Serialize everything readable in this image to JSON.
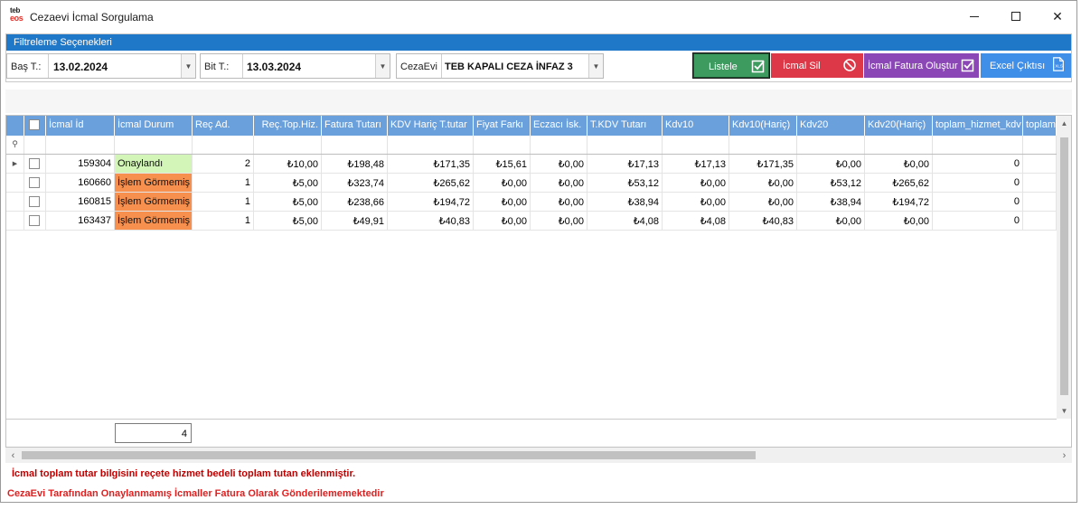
{
  "window": {
    "title": "Cezaevi İcmal Sorgulama",
    "logo_top": "teb",
    "logo_bottom": "eos"
  },
  "filter": {
    "header": "Filtreleme Seçenekleri",
    "start_label": "Baş T.:",
    "start_value": "13.02.2024",
    "end_label": "Bit T.:",
    "end_value": "13.03.2024",
    "prison_label": "CezaEvi",
    "prison_value": "TEB KAPALI CEZA İNFAZ 3"
  },
  "buttons": {
    "list": "Listele",
    "delete": "İcmal Sil",
    "invoice": "İcmal Fatura Oluştur",
    "excel": "Excel Çıktısı"
  },
  "grid": {
    "columns": [
      "İcmal İd",
      "İcmal Durum",
      "Reç Ad.",
      "Reç.Top.Hiz.",
      "Fatura Tutarı",
      "KDV Hariç T.tutar",
      "Fiyat Farkı",
      "Eczacı İsk.",
      "T.KDV Tutarı",
      "Kdv10",
      "Kdv10(Hariç)",
      "Kdv20",
      "Kdv20(Hariç)",
      "toplam_hizmet_kdv",
      "toplam_h"
    ],
    "rows": [
      {
        "id": "159304",
        "status": "Onaylandı",
        "status_type": "ok",
        "rec": "2",
        "hiz": "₺10,00",
        "fatura": "₺198,48",
        "kdvharic": "₺171,35",
        "fiyat": "₺15,61",
        "eczaci": "₺0,00",
        "tkdv": "₺17,13",
        "kdv10": "₺17,13",
        "kdv10h": "₺171,35",
        "kdv20": "₺0,00",
        "kdv20h": "₺0,00",
        "thkdv": "0"
      },
      {
        "id": "160660",
        "status": "İşlem Görmemiş",
        "status_type": "no",
        "rec": "1",
        "hiz": "₺5,00",
        "fatura": "₺323,74",
        "kdvharic": "₺265,62",
        "fiyat": "₺0,00",
        "eczaci": "₺0,00",
        "tkdv": "₺53,12",
        "kdv10": "₺0,00",
        "kdv10h": "₺0,00",
        "kdv20": "₺53,12",
        "kdv20h": "₺265,62",
        "thkdv": "0"
      },
      {
        "id": "160815",
        "status": "İşlem Görmemiş",
        "status_type": "no",
        "rec": "1",
        "hiz": "₺5,00",
        "fatura": "₺238,66",
        "kdvharic": "₺194,72",
        "fiyat": "₺0,00",
        "eczaci": "₺0,00",
        "tkdv": "₺38,94",
        "kdv10": "₺0,00",
        "kdv10h": "₺0,00",
        "kdv20": "₺38,94",
        "kdv20h": "₺194,72",
        "thkdv": "0"
      },
      {
        "id": "163437",
        "status": "İşlem Görmemiş",
        "status_type": "no",
        "rec": "1",
        "hiz": "₺5,00",
        "fatura": "₺49,91",
        "kdvharic": "₺40,83",
        "fiyat": "₺0,00",
        "eczaci": "₺0,00",
        "tkdv": "₺4,08",
        "kdv10": "₺4,08",
        "kdv10h": "₺40,83",
        "kdv20": "₺0,00",
        "kdv20h": "₺0,00",
        "thkdv": "0"
      }
    ],
    "count": "4"
  },
  "notes": {
    "line1": "İcmal toplam tutar bilgisini reçete hizmet bedeli toplam tutan eklenmiştir.",
    "line2": "CezaEvi Tarafından Onaylanmamış İcmaller Fatura Olarak Gönderilememektedir"
  },
  "colors": {
    "header_blue": "#1f78c8",
    "grid_header": "#6aa1dc",
    "approved": "#d3f5b8",
    "not_processed": "#f7904e",
    "btn_list": "#3d9b60",
    "btn_delete": "#dc3848",
    "btn_invoice": "#8b47b5",
    "btn_excel": "#3f8ee8",
    "note_red": "#c00000"
  }
}
